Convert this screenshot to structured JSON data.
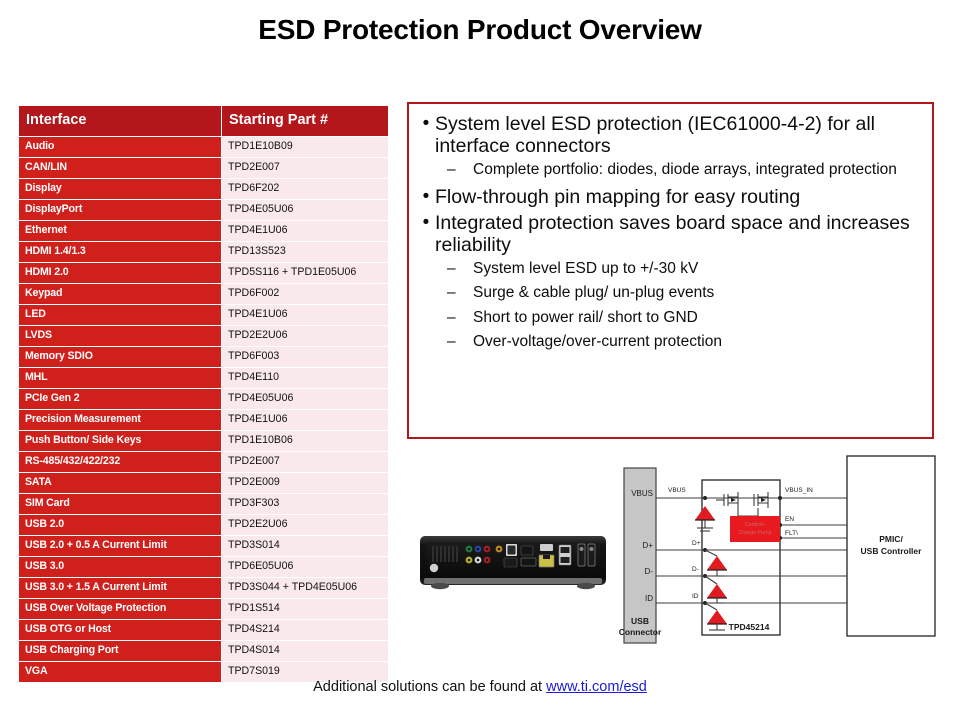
{
  "title": "ESD Protection Product Overview",
  "table": {
    "headers": [
      "Interface",
      "Starting Part #"
    ],
    "rows": [
      [
        "Audio",
        "TPD1E10B09"
      ],
      [
        "CAN/LIN",
        "TPD2E007"
      ],
      [
        "Display",
        "TPD6F202"
      ],
      [
        "DisplayPort",
        "TPD4E05U06"
      ],
      [
        "Ethernet",
        "TPD4E1U06"
      ],
      [
        "HDMI 1.4/1.3",
        "TPD13S523"
      ],
      [
        "HDMI 2.0",
        "TPD5S116 + TPD1E05U06"
      ],
      [
        "Keypad",
        "TPD6F002"
      ],
      [
        "LED",
        "TPD4E1U06"
      ],
      [
        "LVDS",
        "TPD2E2U06"
      ],
      [
        "Memory SDIO",
        "TPD6F003"
      ],
      [
        "MHL",
        "TPD4E110"
      ],
      [
        "PCIe Gen 2",
        "TPD4E05U06"
      ],
      [
        "Precision Measurement",
        "TPD4E1U06"
      ],
      [
        "Push Button/ Side Keys",
        "TPD1E10B06"
      ],
      [
        "RS-485/432/422/232",
        "TPD2E007"
      ],
      [
        "SATA",
        "TPD2E009"
      ],
      [
        "SIM Card",
        "TPD3F303"
      ],
      [
        "USB 2.0",
        "TPD2E2U06"
      ],
      [
        "USB 2.0 + 0.5  A Current Limit",
        "TPD3S014"
      ],
      [
        "USB 3.0",
        "TPD6E05U06"
      ],
      [
        "USB 3.0 + 1.5  A Current Limit",
        "TPD3S044 + TPD4E05U06"
      ],
      [
        "USB Over Voltage Protection",
        "TPD1S514"
      ],
      [
        "USB OTG or Host",
        "TPD4S214"
      ],
      [
        "USB Charging Port",
        "TPD4S014"
      ],
      [
        "VGA",
        "TPD7S019"
      ]
    ]
  },
  "bullets": [
    {
      "level": 1,
      "marker": "•",
      "text": "System level ESD protection (IEC61000-4-2) for all interface connectors"
    },
    {
      "level": 2,
      "marker": "–",
      "text": "Complete portfolio: diodes, diode arrays, integrated protection"
    },
    {
      "level": 1,
      "marker": "•",
      "text": "Flow-through pin mapping for easy routing"
    },
    {
      "level": 1,
      "marker": "•",
      "text": "Integrated protection saves board space and increases reliability"
    },
    {
      "level": 2,
      "marker": "–",
      "text": "System level ESD up to +/-30 kV"
    },
    {
      "level": 2,
      "marker": "–",
      "text": "Surge & cable plug/ un-plug events"
    },
    {
      "level": 2,
      "marker": "–",
      "text": "Short to power rail/ short to GND"
    },
    {
      "level": 2,
      "marker": "–",
      "text": "Over-voltage/over-current protection"
    }
  ],
  "schematic": {
    "connector_label_line1": "USB",
    "connector_label_line2": "Connector",
    "connector_pins": [
      "VBUS",
      "D+",
      "D-",
      "ID"
    ],
    "net_labels_left": [
      "VBUS",
      "D+",
      "D-",
      "ID"
    ],
    "device_label": "TPD45214",
    "device_block_text_line1": "Control+",
    "device_block_text_line2": "Charge Pump",
    "net_labels_right": [
      "VBUS_IN",
      "EN",
      "FLT\\"
    ],
    "controller_label_line1": "PMIC/",
    "controller_label_line2": "USB Controller"
  },
  "footer": {
    "text": "Additional solutions can be found at ",
    "link": "www.ti.com/esd"
  },
  "colors": {
    "header_red": "#B3161B",
    "row_red": "#D0201C",
    "row_pink": "#FAE9EA",
    "link_blue": "#1c1cd6",
    "diode_red": "#E01B22",
    "block_gray": "#C6C6C6"
  }
}
